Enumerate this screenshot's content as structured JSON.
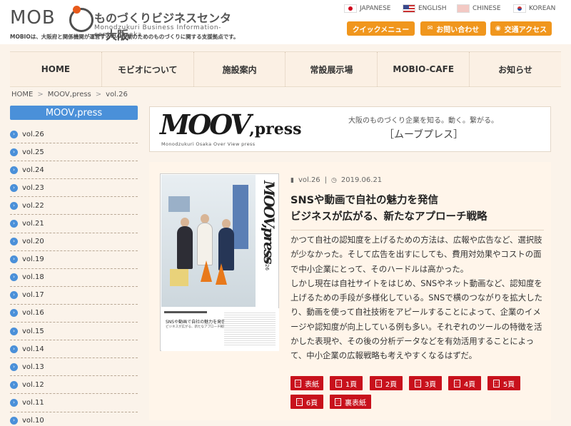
{
  "header": {
    "logo_word": "MOBIO",
    "logo_jp": "ものづくりビジネスセンター大阪",
    "logo_en": "Monodzukuri Business Information-center Osaka",
    "logo_desc": "MOBIOは、大阪府と関係機関が運営する中小企業のためのものづくりに関する支援拠点です。",
    "languages": [
      {
        "label": "JAPANESE",
        "flag": "jp-flag-icon"
      },
      {
        "label": "ENGLISH",
        "flag": "us-flag-icon"
      },
      {
        "label": "CHINESE",
        "flag": "cn-flag-icon"
      },
      {
        "label": "KOREAN",
        "flag": "kr-flag-icon"
      }
    ],
    "buttons": {
      "quick_menu": "クイックメニュー",
      "contact": "お問い合わせ",
      "access": "交通アクセス"
    },
    "accent_color": "#f0961d"
  },
  "nav": [
    "HOME",
    "モビオについて",
    "施設案内",
    "常設展示場",
    "MOBIO-CAFE",
    "お知らせ"
  ],
  "breadcrumb": {
    "home": "HOME",
    "section": "MOOV,press",
    "current": "vol.26"
  },
  "sidebar": {
    "title": "MOOV,press",
    "items": [
      "vol.26",
      "vol.25",
      "vol.24",
      "vol.23",
      "vol.22",
      "vol.21",
      "vol.20",
      "vol.19",
      "vol.18",
      "vol.17",
      "vol.16",
      "vol.15",
      "vol.14",
      "vol.13",
      "vol.12",
      "vol.11",
      "vol.10"
    ]
  },
  "banner": {
    "logo_main": "MOOV",
    "logo_press": ",press",
    "logo_sub": "Monodzukuri Osaka Over View press",
    "tagline": "大阪のものづくり企業を知る。動く。繋がる。",
    "kana": "［ムーブプレス］"
  },
  "article": {
    "volume": "vol.26",
    "separator": "|",
    "date": "2019.06.21",
    "title_line1": "SNSや動画で自社の魅力を発信",
    "title_line2": "ビジネスが広がる、新たなアプローチ戦略",
    "body": "かつて自社の認知度を上げるための方法は、広報や広告など、選択肢が少なかった。そして広告を出すにしても、費用対効果やコストの面で中小企業にとって、そのハードルは高かった。\nしかし現在は自社サイトをはじめ、SNSやネット動画など、認知度を上げるための手段が多様化している。SNSで横のつながりを拡大したり、動画を使って自社技術をアピールすることによって、企業のイメージや認知度が向上している例も多い。それぞれのツールの特徴を活かした表現や、その後の分析データなどを有効活用することによって、中小企業の広報戦略も考えやすくなるはずだ。",
    "cover": {
      "side_title": "MOOV,press",
      "side_vol": "vol.026",
      "headline": "SNSや動画で自社の魅力を発信",
      "subline": "ビジネスが広がる、新たなアプローチ戦略"
    },
    "pdf_links": [
      "表紙",
      "1頁",
      "2頁",
      "3頁",
      "4頁",
      "5頁",
      "6頁",
      "裏表紙"
    ],
    "pdf_color": "#c8111c"
  }
}
